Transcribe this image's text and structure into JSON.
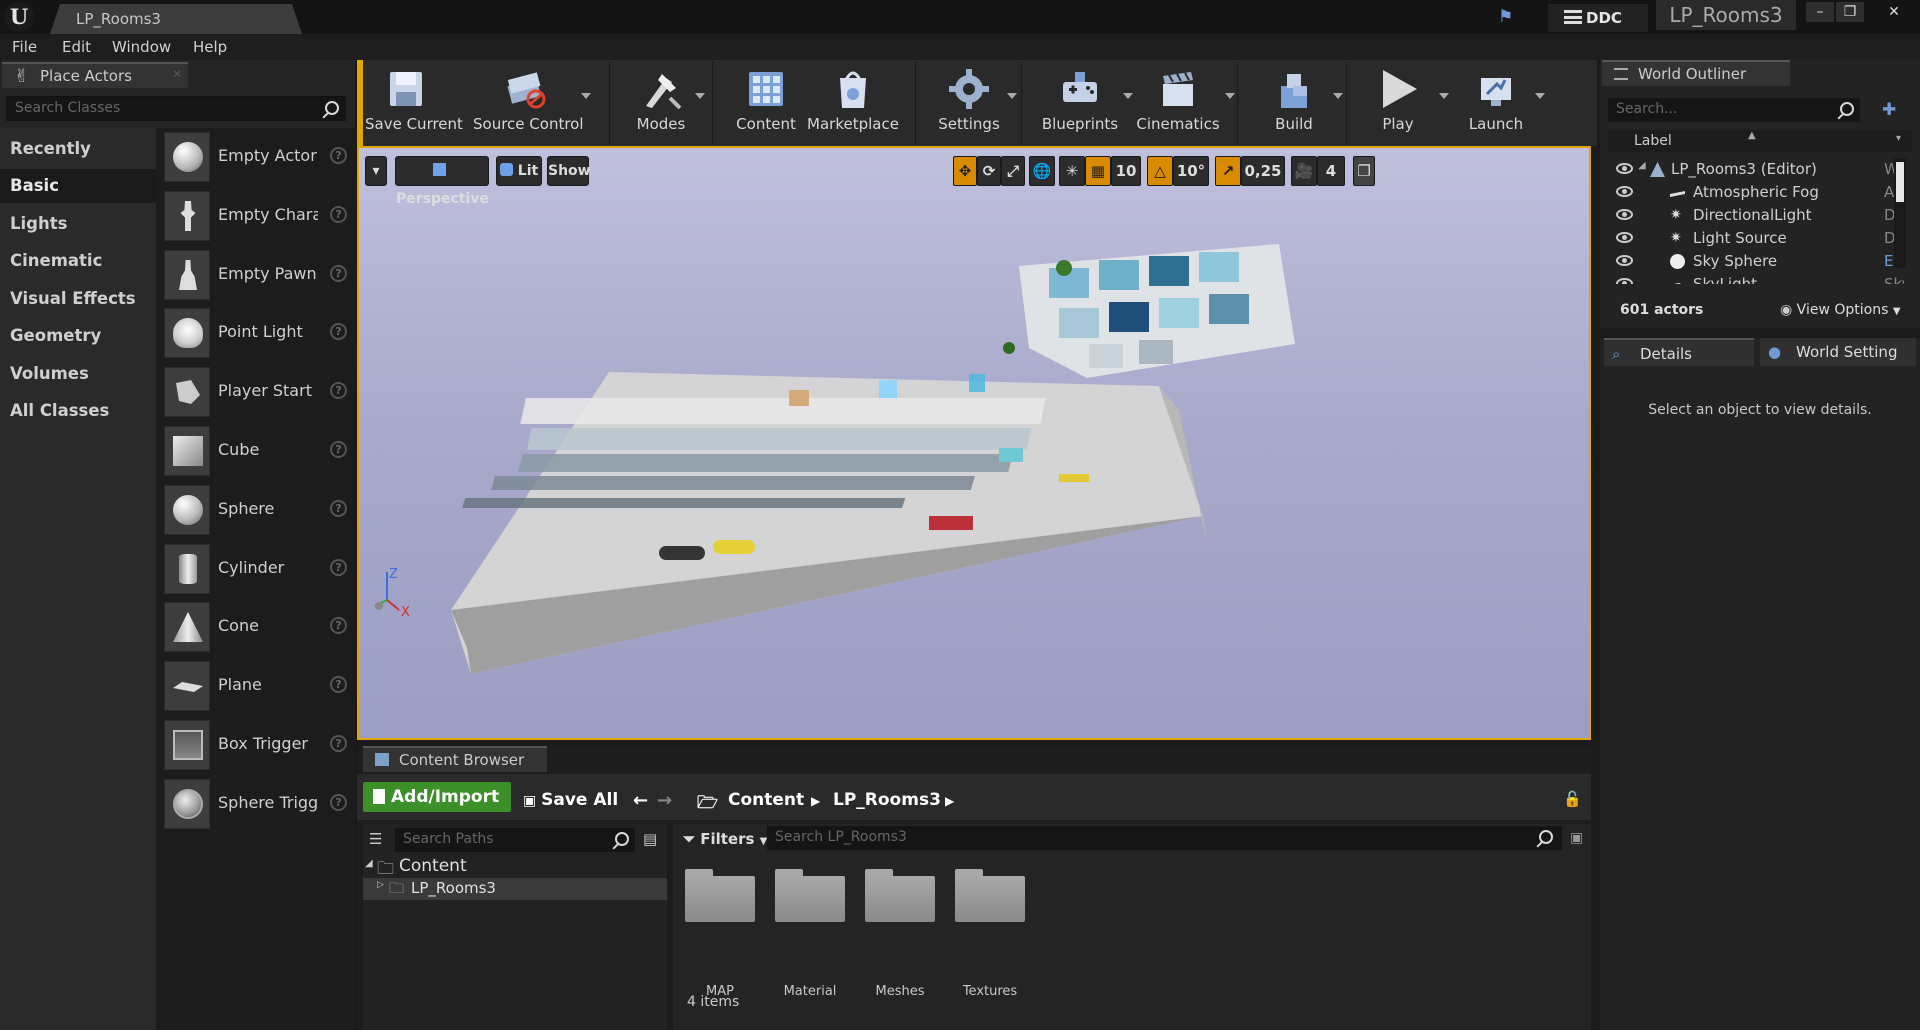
{
  "window": {
    "doc_tab": "LP_Rooms3",
    "ddc_label": "DDC",
    "project_name": "LP_Rooms3"
  },
  "menu": [
    "File",
    "Edit",
    "Window",
    "Help"
  ],
  "place_actors": {
    "tab_label": "Place Actors",
    "search_placeholder": "Search Classes",
    "categories": [
      "Recently Placed",
      "Basic",
      "Lights",
      "Cinematic",
      "Visual Effects",
      "Geometry",
      "Volumes",
      "All Classes"
    ],
    "active_category": "Basic",
    "actors": [
      "Empty Actor",
      "Empty Character",
      "Empty Pawn",
      "Point Light",
      "Player Start",
      "Cube",
      "Sphere",
      "Cylinder",
      "Cone",
      "Plane",
      "Box Trigger",
      "Sphere Trigger"
    ]
  },
  "toolbar": {
    "save_current": "Save Current",
    "source_control": "Source Control",
    "modes": "Modes",
    "content": "Content",
    "marketplace": "Marketplace",
    "settings": "Settings",
    "blueprints": "Blueprints",
    "cinematics": "Cinematics",
    "build": "Build",
    "play": "Play",
    "launch": "Launch"
  },
  "viewport": {
    "perspective": "Perspective",
    "lit": "Lit",
    "show": "Show",
    "grid_snap": "10",
    "rotation_snap": "10°",
    "scale_snap": "0,25",
    "camera_speed": "4",
    "axis_z": "Z",
    "axis_x": "X"
  },
  "outliner": {
    "tab_label": "World Outliner",
    "search_placeholder": "Search...",
    "column_label": "Label",
    "rows": [
      {
        "label": "LP_Rooms3 (Editor)",
        "type": "World"
      },
      {
        "label": "Atmospheric Fog",
        "type": "AtmosphericFog"
      },
      {
        "label": "DirectionalLight",
        "type": "DirectionalLight"
      },
      {
        "label": "Light Source",
        "type": "DirectionalLight"
      },
      {
        "label": "Sky Sphere",
        "type": "Edit BP_Sky_Sphere"
      },
      {
        "label": "SkyLight",
        "type": "SkyLight"
      }
    ],
    "actor_count": "601 actors",
    "view_options": "View Options"
  },
  "details": {
    "tab_details": "Details",
    "tab_world": "World Setting",
    "empty_message": "Select an object to view details."
  },
  "content_browser": {
    "tab_label": "Content Browser",
    "add_import": "Add/Import",
    "save_all": "Save All",
    "crumbs": [
      "Content",
      "LP_Rooms3"
    ],
    "path_search_placeholder": "Search Paths",
    "tree": [
      "Content",
      "LP_Rooms3"
    ],
    "filters": "Filters",
    "asset_search_placeholder": "Search LP_Rooms3",
    "folders": [
      "MAP",
      "Material",
      "Meshes",
      "Textures"
    ],
    "item_count": "4 items"
  },
  "colors": {
    "accent_orange": "#e1a600",
    "add_green": "#3d8f2a",
    "viewport_sky": "#a9aacc"
  }
}
